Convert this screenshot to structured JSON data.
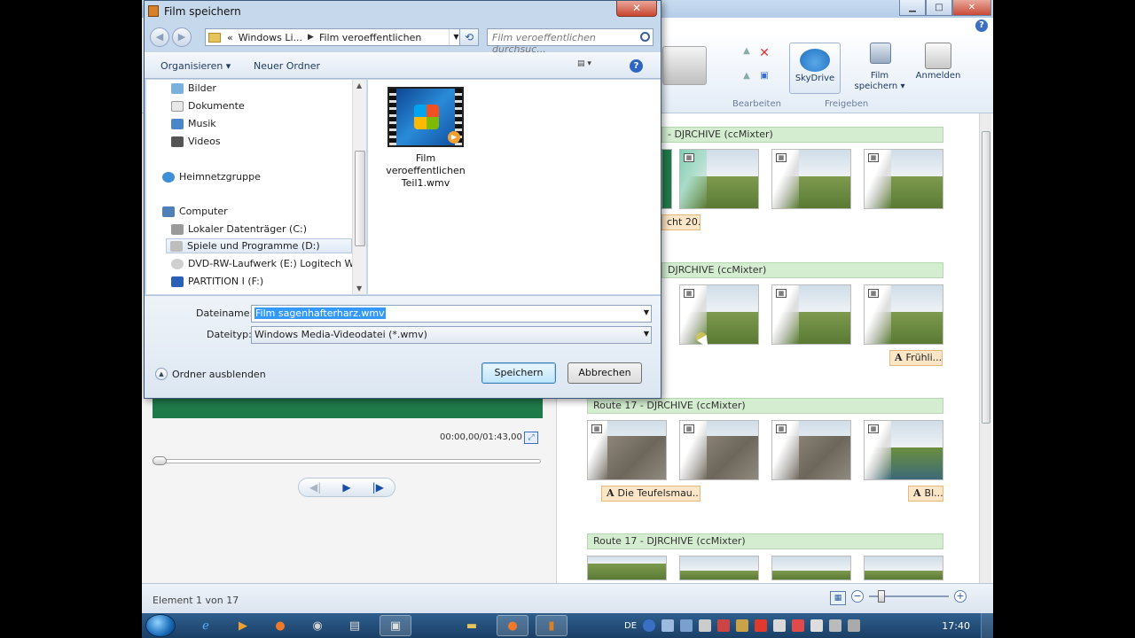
{
  "dialog": {
    "title": "Film speichern",
    "close": "✕",
    "address": {
      "root": "«",
      "crumb1": "Windows Li...",
      "crumb2": "Film veroeffentlichen"
    },
    "search_placeholder": "Film veroeffentlichen durchsuc...",
    "toolbar": {
      "organize": "Organisieren ▾",
      "new_folder": "Neuer Ordner",
      "help": "?"
    },
    "nav_items": [
      {
        "label": "Bilder"
      },
      {
        "label": "Dokumente"
      },
      {
        "label": "Musik"
      },
      {
        "label": "Videos"
      },
      {
        "label": "Heimnetzgruppe"
      },
      {
        "label": "Computer"
      },
      {
        "label": "Lokaler Datenträger (C:)"
      },
      {
        "label": "Spiele und Programme (D:)"
      },
      {
        "label": "DVD-RW-Laufwerk (E:) Logitech Web"
      },
      {
        "label": "PARTITION I (F:)"
      }
    ],
    "file": {
      "name": "Film veroeffentlichen Teil1.wmv"
    },
    "filename_label": "Dateiname:",
    "filename_value": "Film sagenhafterharz.wmv",
    "filetype_label": "Dateityp:",
    "filetype_value": "Windows Media-Videodatei (*.wmv)",
    "hide_folders": "Ordner ausblenden",
    "save_button": "Speichern",
    "cancel_button": "Abbrechen"
  },
  "moviemaker": {
    "ribbon": {
      "skydrive": "SkyDrive",
      "save_movie": "Film speichern ▾",
      "sign_in": "Anmelden",
      "group_edit": "Bearbeiten",
      "group_share": "Freigeben"
    },
    "time_readout": "00:00,00/01:43,00",
    "tracks": [
      {
        "label": "- DJRCHIVE (ccMixter)",
        "caption": "cht 20..."
      },
      {
        "label": "DJRCHIVE (ccMixter)",
        "caption": "Frühli..."
      },
      {
        "label": "Route 17  - DJRCHIVE (ccMixter)",
        "caption1": "Die Teufelsmau...",
        "caption2": "Bl..."
      },
      {
        "label": "Route 17  - DJRCHIVE (ccMixter)"
      }
    ],
    "status": "Element 1 von 17"
  },
  "taskbar": {
    "lang": "DE",
    "clock": "17:40"
  }
}
